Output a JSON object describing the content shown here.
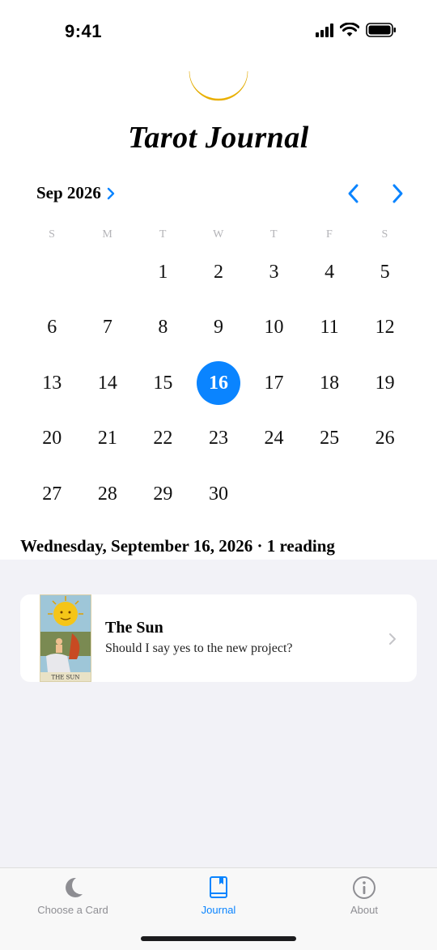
{
  "status_bar": {
    "time": "9:41"
  },
  "app": {
    "title": "Tarot Journal"
  },
  "calendar": {
    "month_label": "Sep 2026",
    "weekdays": [
      "S",
      "M",
      "T",
      "W",
      "T",
      "F",
      "S"
    ],
    "leading_blanks": 2,
    "days": [
      "1",
      "2",
      "3",
      "4",
      "5",
      "6",
      "7",
      "8",
      "9",
      "10",
      "11",
      "12",
      "13",
      "14",
      "15",
      "16",
      "17",
      "18",
      "19",
      "20",
      "21",
      "22",
      "23",
      "24",
      "25",
      "26",
      "27",
      "28",
      "29",
      "30"
    ],
    "selected_day": "16",
    "accent_color": "#0a84ff"
  },
  "selection": {
    "heading": "Wednesday, September 16, 2026 · 1 reading"
  },
  "readings": [
    {
      "card_name": "The Sun",
      "question": "Should I say yes to the new project?",
      "thumb_caption": "THE SUN"
    }
  ],
  "tab_bar": {
    "tabs": [
      {
        "label": "Choose a Card",
        "icon": "moon-icon"
      },
      {
        "label": "Journal",
        "icon": "book-icon",
        "active": true
      },
      {
        "label": "About",
        "icon": "info-icon"
      }
    ]
  }
}
